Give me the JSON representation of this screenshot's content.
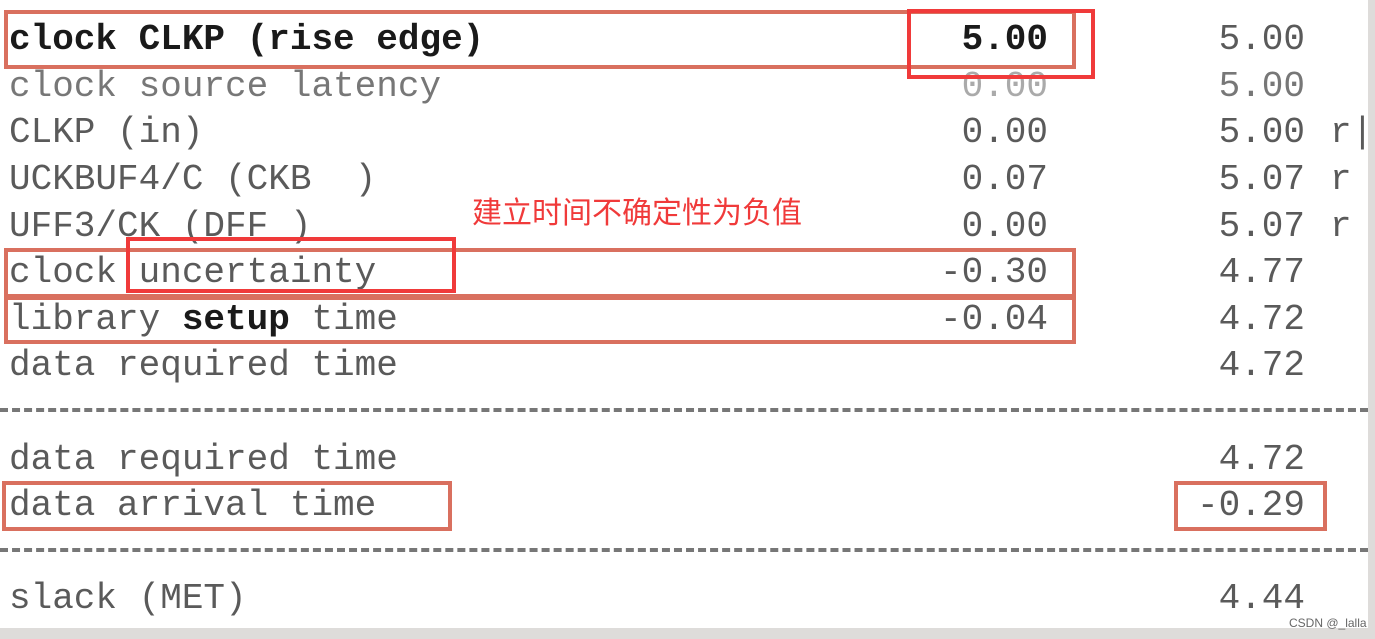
{
  "rows": [
    {
      "label": "clock CLKP (rise edge)",
      "incr": "5.00",
      "path": "5.00",
      "flag": ""
    },
    {
      "label": "clock source latency",
      "incr": "0.00",
      "path": "5.00",
      "flag": ""
    },
    {
      "label": "CLKP (in)",
      "incr": "0.00",
      "path": "5.00",
      "flag": "r|"
    },
    {
      "label": "UCKBUF4/C (CKB  )",
      "incr": "0.07",
      "path": "5.07",
      "flag": "r"
    },
    {
      "label": "UFF3/CK (DFF )",
      "incr": "0.00",
      "path": "5.07",
      "flag": "r"
    },
    {
      "label": "clock uncertainty",
      "incr": "-0.30",
      "path": "4.77",
      "flag": ""
    },
    {
      "label_pre": "library ",
      "label_bold": "setup",
      "label_post": " time",
      "incr": "-0.04",
      "path": "4.72",
      "flag": ""
    },
    {
      "label": "data required time",
      "incr": "",
      "path": "4.72",
      "flag": ""
    }
  ],
  "summary": [
    {
      "label": "data required time",
      "path": "4.72"
    },
    {
      "label": "data arrival time",
      "path": "-0.29"
    }
  ],
  "slack": {
    "label": "slack (MET)",
    "path": "4.44"
  },
  "annotation": "建立时间不确定性为负值",
  "watermark": "CSDN @_lalla",
  "colors": {
    "box": "#d9705f",
    "highlight": "#f03a3a"
  }
}
